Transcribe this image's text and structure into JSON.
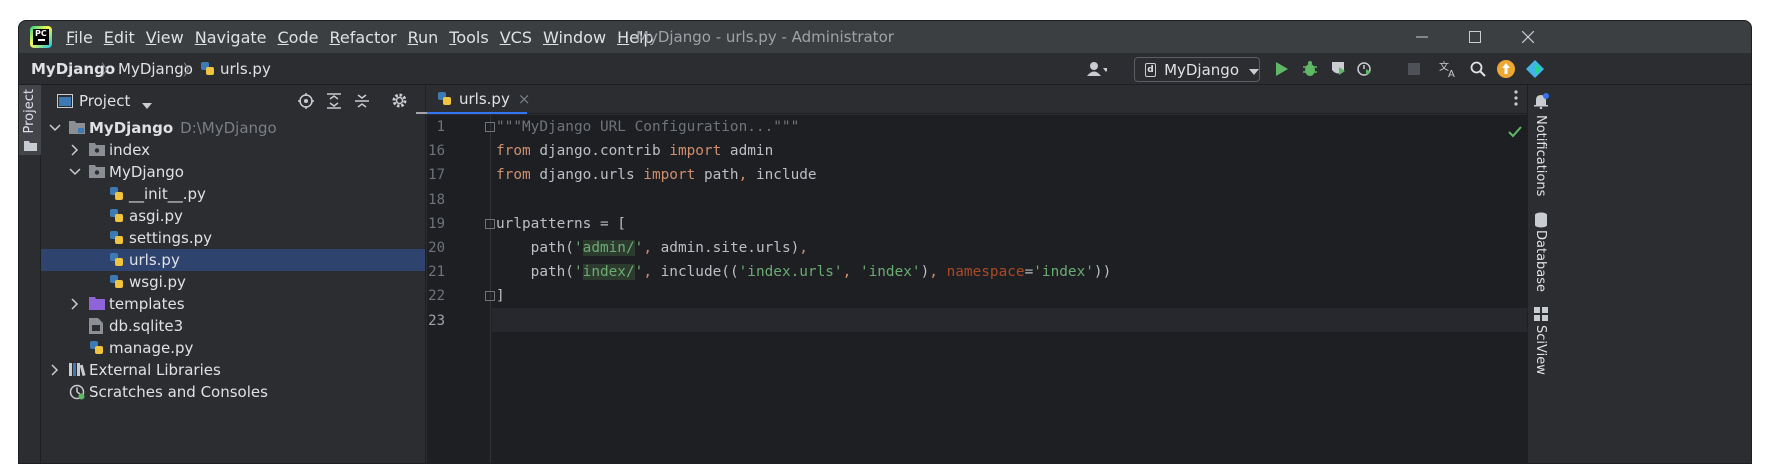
{
  "window": {
    "title": "MyDjango - urls.py - Administrator",
    "minimize_glyph": "—",
    "maximize_glyph": "☐",
    "close_glyph": "✕"
  },
  "menu": [
    "File",
    "Edit",
    "View",
    "Navigate",
    "Code",
    "Refactor",
    "Run",
    "Tools",
    "VCS",
    "Window",
    "Help"
  ],
  "menu_mnemonic": [
    "F",
    "E",
    "V",
    "N",
    "C",
    "R",
    "R",
    "T",
    "V",
    "W",
    "H"
  ],
  "breadcrumbs": [
    "MyDjango",
    "MyDjango",
    "urls.py"
  ],
  "run_config": {
    "label": "MyDjango"
  },
  "left_strip": {
    "project_label": "Project"
  },
  "project_panel": {
    "title": "Project",
    "tree": [
      {
        "label": "MyDjango",
        "sub": "D:\\MyDjango",
        "depth": 0,
        "arrow": "down",
        "icon": "folder-module-icon"
      },
      {
        "label": "index",
        "sub": "",
        "depth": 1,
        "arrow": "right",
        "icon": "package-folder-icon"
      },
      {
        "label": "MyDjango",
        "sub": "",
        "depth": 1,
        "arrow": "down",
        "icon": "package-folder-icon"
      },
      {
        "label": "__init__.py",
        "sub": "",
        "depth": 2,
        "arrow": "",
        "icon": "python-file-icon"
      },
      {
        "label": "asgi.py",
        "sub": "",
        "depth": 2,
        "arrow": "",
        "icon": "python-file-icon"
      },
      {
        "label": "settings.py",
        "sub": "",
        "depth": 2,
        "arrow": "",
        "icon": "python-file-icon"
      },
      {
        "label": "urls.py",
        "sub": "",
        "depth": 2,
        "arrow": "",
        "icon": "python-file-icon",
        "selected": true
      },
      {
        "label": "wsgi.py",
        "sub": "",
        "depth": 2,
        "arrow": "",
        "icon": "python-file-icon"
      },
      {
        "label": "templates",
        "sub": "",
        "depth": 1,
        "arrow": "right",
        "icon": "templates-folder-icon"
      },
      {
        "label": "db.sqlite3",
        "sub": "",
        "depth": 1,
        "arrow": "",
        "icon": "database-file-icon"
      },
      {
        "label": "manage.py",
        "sub": "",
        "depth": 1,
        "arrow": "",
        "icon": "python-file-icon"
      },
      {
        "label": "External Libraries",
        "sub": "",
        "depth": 0,
        "arrow": "right",
        "icon": "library-icon"
      },
      {
        "label": "Scratches and Consoles",
        "sub": "",
        "depth": 0,
        "arrow": "",
        "icon": "scratches-icon"
      }
    ]
  },
  "editor": {
    "tab_label": "urls.py",
    "tab_close": "×",
    "line_numbers": [
      "1",
      "16",
      "17",
      "18",
      "19",
      "20",
      "21",
      "22",
      "23"
    ],
    "current_line_index": 8,
    "lines": [
      [
        {
          "t": "\"\"\"MyDjango URL Configuration...\"\"\"",
          "c": "docstr"
        }
      ],
      [
        {
          "t": "from",
          "c": "kw"
        },
        {
          "t": " django.contrib ",
          "c": ""
        },
        {
          "t": "import",
          "c": "kw"
        },
        {
          "t": " admin",
          "c": ""
        }
      ],
      [
        {
          "t": "from",
          "c": "kw"
        },
        {
          "t": " django.urls ",
          "c": ""
        },
        {
          "t": "import",
          "c": "kw"
        },
        {
          "t": " path",
          "c": ""
        },
        {
          "t": ",",
          "c": "kw"
        },
        {
          "t": " include",
          "c": ""
        }
      ],
      [],
      [
        {
          "t": "urlpatterns = [",
          "c": ""
        }
      ],
      [
        {
          "t": "    path(",
          "c": ""
        },
        {
          "t": "'",
          "c": "str"
        },
        {
          "t": "admin/",
          "c": "str hl"
        },
        {
          "t": "'",
          "c": "str"
        },
        {
          "t": ",",
          "c": "kw"
        },
        {
          "t": " admin.site.urls)",
          "c": ""
        },
        {
          "t": ",",
          "c": "kw"
        }
      ],
      [
        {
          "t": "    path(",
          "c": ""
        },
        {
          "t": "'",
          "c": "str"
        },
        {
          "t": "index/",
          "c": "str hl"
        },
        {
          "t": "'",
          "c": "str"
        },
        {
          "t": ",",
          "c": "kw"
        },
        {
          "t": " include((",
          "c": ""
        },
        {
          "t": "'index.urls'",
          "c": "str"
        },
        {
          "t": ",",
          "c": "kw"
        },
        {
          "t": " ",
          "c": ""
        },
        {
          "t": "'index'",
          "c": "str"
        },
        {
          "t": ")",
          "c": ""
        },
        {
          "t": ",",
          "c": "kw"
        },
        {
          "t": " ",
          "c": ""
        },
        {
          "t": "namespace",
          "c": "param"
        },
        {
          "t": "=",
          "c": ""
        },
        {
          "t": "'index'",
          "c": "str"
        },
        {
          "t": "))",
          "c": ""
        }
      ],
      [
        {
          "t": "]",
          "c": ""
        }
      ],
      []
    ]
  },
  "right_strip": [
    "Notifications",
    "Database",
    "SciView"
  ],
  "colors": {
    "accent": "#3574f0",
    "run_green": "#5fb865",
    "update_orange": "#f0a732"
  }
}
